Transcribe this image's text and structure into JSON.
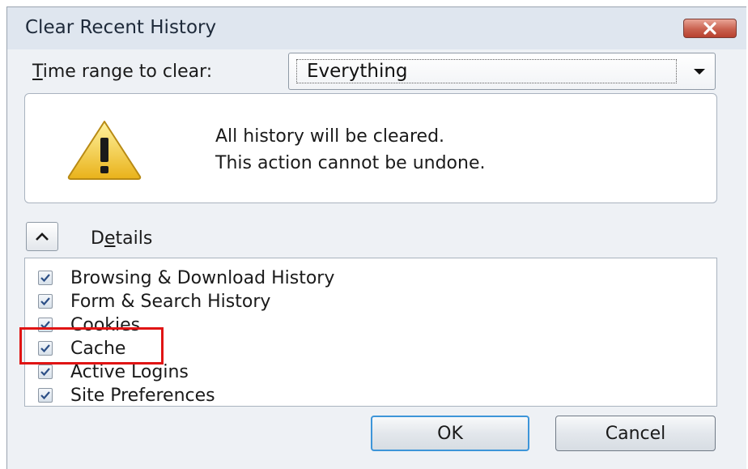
{
  "window": {
    "title": "Clear Recent History",
    "close_icon": "close-icon"
  },
  "time_range": {
    "label_prefix": "T",
    "label_rest": "ime range to clear:",
    "selected": "Everything"
  },
  "warning": {
    "icon": "warning-icon",
    "line1": "All history will be cleared.",
    "line2": "This action cannot be undone."
  },
  "details": {
    "toggle_icon": "chevron-up-icon",
    "label_pre": "D",
    "label_acc": "e",
    "label_post": "tails"
  },
  "items": [
    {
      "label": "Browsing & Download History",
      "checked": true
    },
    {
      "label": "Form & Search History",
      "checked": true
    },
    {
      "label": "Cookies",
      "checked": true
    },
    {
      "label": "Cache",
      "checked": true,
      "highlighted": true
    },
    {
      "label": "Active Logins",
      "checked": true
    },
    {
      "label": "Site Preferences",
      "checked": true
    }
  ],
  "buttons": {
    "ok": "OK",
    "cancel": "Cancel"
  },
  "colors": {
    "highlight": "#e01414",
    "close_button": "#c9614f",
    "ok_focus_border": "#3d95d9"
  }
}
